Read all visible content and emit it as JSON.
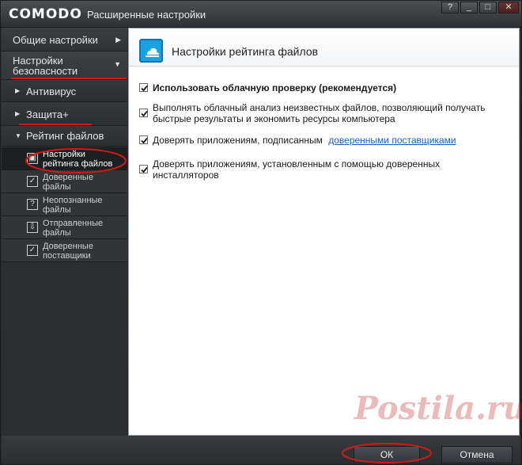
{
  "window": {
    "logo": "COMODO",
    "title": "Расширенные настройки",
    "buttons": [
      "?",
      "_",
      "□",
      "✕"
    ]
  },
  "sidebar": {
    "top_items": [
      {
        "label": "Общие настройки"
      },
      {
        "label": "Настройки безопасности"
      }
    ],
    "security_items": [
      {
        "label": "Антивирус"
      },
      {
        "label": "Защита+"
      },
      {
        "label": "Рейтинг файлов"
      }
    ],
    "sub_items": [
      {
        "line1": "Настройки",
        "line2": "рейтинга файлов",
        "icon": "file-rating-settings-icon",
        "glyph": "▣"
      },
      {
        "line1": "Доверенные",
        "line2": "файлы",
        "icon": "trusted-files-icon",
        "glyph": "✓"
      },
      {
        "line1": "Неопознанные",
        "line2": "файлы",
        "icon": "unrecognized-files-icon",
        "glyph": "?"
      },
      {
        "line1": "Отправленные",
        "line2": "файлы",
        "icon": "submitted-files-icon",
        "glyph": "⇩"
      },
      {
        "line1": "Доверенные",
        "line2": "поставщики",
        "icon": "trusted-vendors-icon",
        "glyph": "✓"
      }
    ]
  },
  "content": {
    "header_title": "Настройки рейтинга файлов",
    "options": [
      {
        "line1": "Использовать облачную проверку (рекомендуется)",
        "checked": true
      },
      {
        "line1": "Выполнять облачный анализ неизвестных файлов, позволяющий получать",
        "line2": "быстрые результаты и экономить ресурсы компьютера",
        "checked": true
      },
      {
        "line1": "Доверять приложениям, подписанным",
        "link": "доверенными поставщиками",
        "checked": true
      },
      {
        "line1": "Доверять приложениям, установленным с помощью доверенных",
        "line2": "инсталляторов",
        "checked": true
      }
    ]
  },
  "footer": {
    "ok_label": "ОК",
    "cancel_label": "Отмена"
  },
  "watermark": "Postila.ru",
  "colors": {
    "accent": "#1ba1e2",
    "annotation": "#d21919",
    "link": "#1a5fc7"
  }
}
